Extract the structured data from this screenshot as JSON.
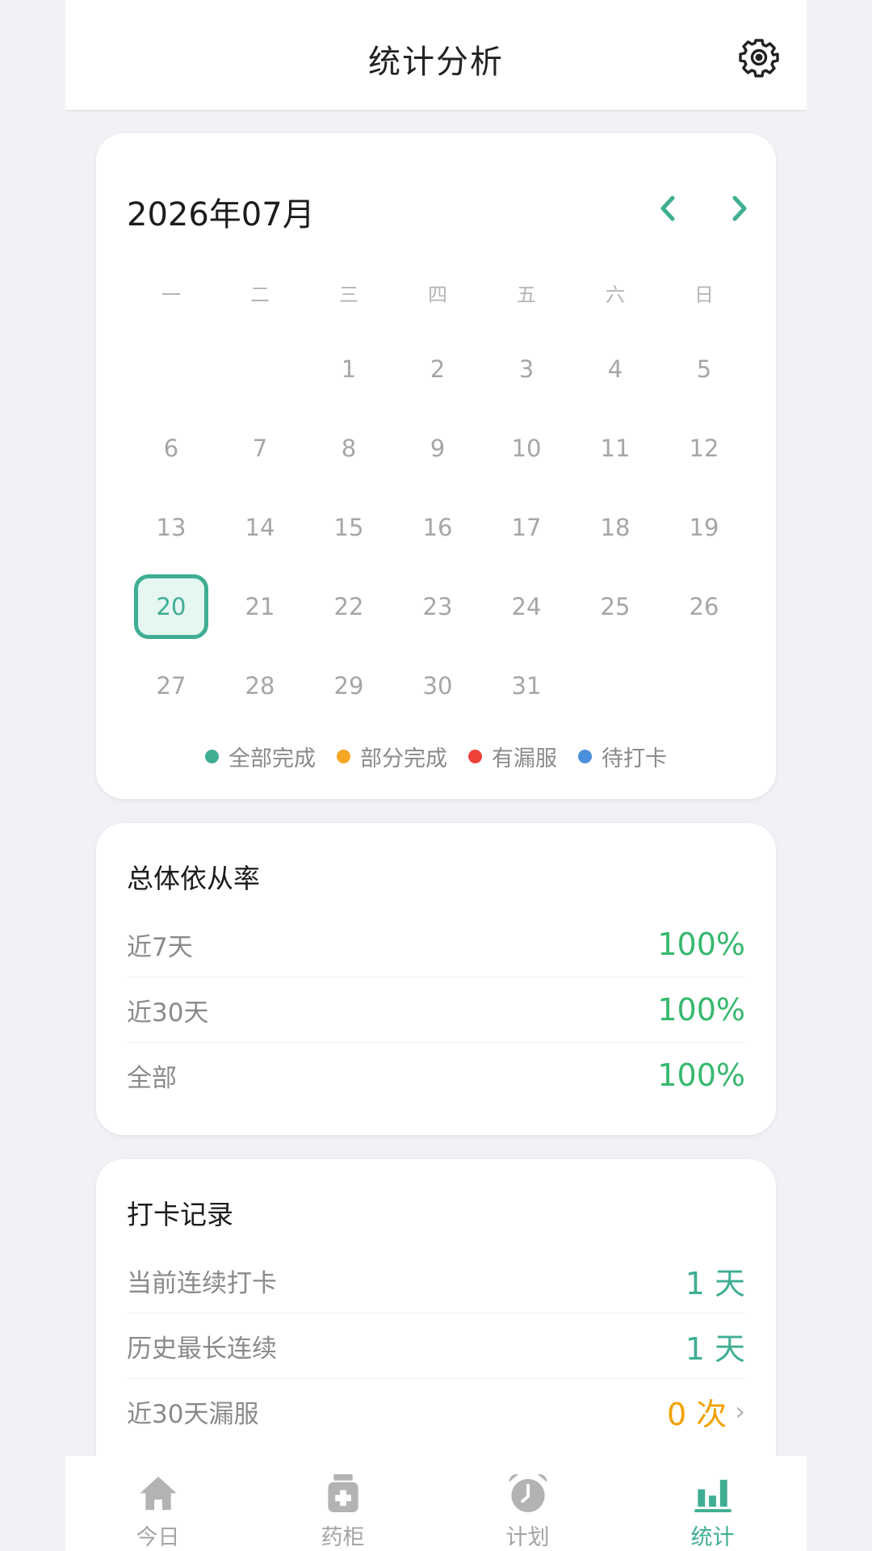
{
  "header": {
    "title": "统计分析"
  },
  "calendar": {
    "month_title": "2026年07月",
    "prev_glyph": "‹",
    "next_glyph": "›",
    "weekdays": [
      "一",
      "二",
      "三",
      "四",
      "五",
      "六",
      "日"
    ],
    "days": [
      "",
      "",
      "1",
      "2",
      "3",
      "4",
      "5",
      "6",
      "7",
      "8",
      "9",
      "10",
      "11",
      "12",
      "13",
      "14",
      "15",
      "16",
      "17",
      "18",
      "19",
      "20",
      "21",
      "22",
      "23",
      "24",
      "25",
      "26",
      "27",
      "28",
      "29",
      "30",
      "31"
    ],
    "selected_day": "20",
    "legend": [
      {
        "label": "全部完成",
        "color": "#3fae93"
      },
      {
        "label": "部分完成",
        "color": "#f5a623"
      },
      {
        "label": "有漏服",
        "color": "#f0413a"
      },
      {
        "label": "待打卡",
        "color": "#4a8fdc"
      }
    ]
  },
  "adherence": {
    "title": "总体依从率",
    "rows": [
      {
        "label": "近7天",
        "value": "100%"
      },
      {
        "label": "近30天",
        "value": "100%"
      },
      {
        "label": "全部",
        "value": "100%"
      }
    ]
  },
  "records": {
    "title": "打卡记录",
    "rows": [
      {
        "label": "当前连续打卡",
        "value": "1 天"
      },
      {
        "label": "历史最长连续",
        "value": "1 天"
      },
      {
        "label": "近30天漏服",
        "value": "0 次"
      }
    ],
    "chevron": "›"
  },
  "tabs": [
    {
      "label": "今日",
      "icon": "home-icon"
    },
    {
      "label": "药柜",
      "icon": "medicine-cabinet-icon"
    },
    {
      "label": "计划",
      "icon": "alarm-clock-icon"
    },
    {
      "label": "统计",
      "icon": "bar-chart-icon"
    }
  ],
  "colors": {
    "accent": "#3fae93",
    "percent_green": "#37b86e",
    "warning_orange": "#f2a100",
    "tab_inactive": "#a4a4a4"
  }
}
